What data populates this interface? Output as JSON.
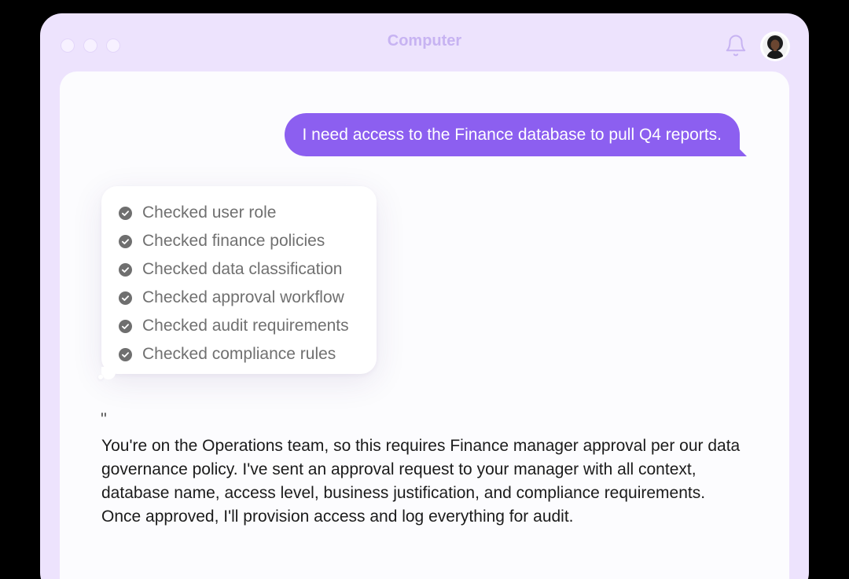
{
  "window": {
    "title": "Computer",
    "icons": [
      "bell-icon",
      "avatar"
    ]
  },
  "chat": {
    "user_message": "I need access to the Finance database to pull Q4 reports.",
    "checks": [
      {
        "label": "Checked user role",
        "icon": "check-circle-icon"
      },
      {
        "label": "Checked finance policies",
        "icon": "check-circle-icon"
      },
      {
        "label": "Checked data classification",
        "icon": "check-circle-icon"
      },
      {
        "label": "Checked approval workflow",
        "icon": "check-circle-icon"
      },
      {
        "label": "Checked audit requirements",
        "icon": "check-circle-icon"
      },
      {
        "label": "Checked compliance rules",
        "icon": "check-circle-icon"
      }
    ],
    "quote_mark": "\"",
    "response_lines": [
      "You're on the Operations team, so this requires Finance manager approval per our data",
      "governance policy. I've sent an approval request to your manager with all context,",
      "database name, access level, business justification, and compliance requirements.",
      "Once approved, I'll provision access and log everything for audit."
    ]
  },
  "colors": {
    "accent": "#8c5ff0",
    "window_bg": "#ede3fd",
    "title_color": "#c7b3f2"
  }
}
